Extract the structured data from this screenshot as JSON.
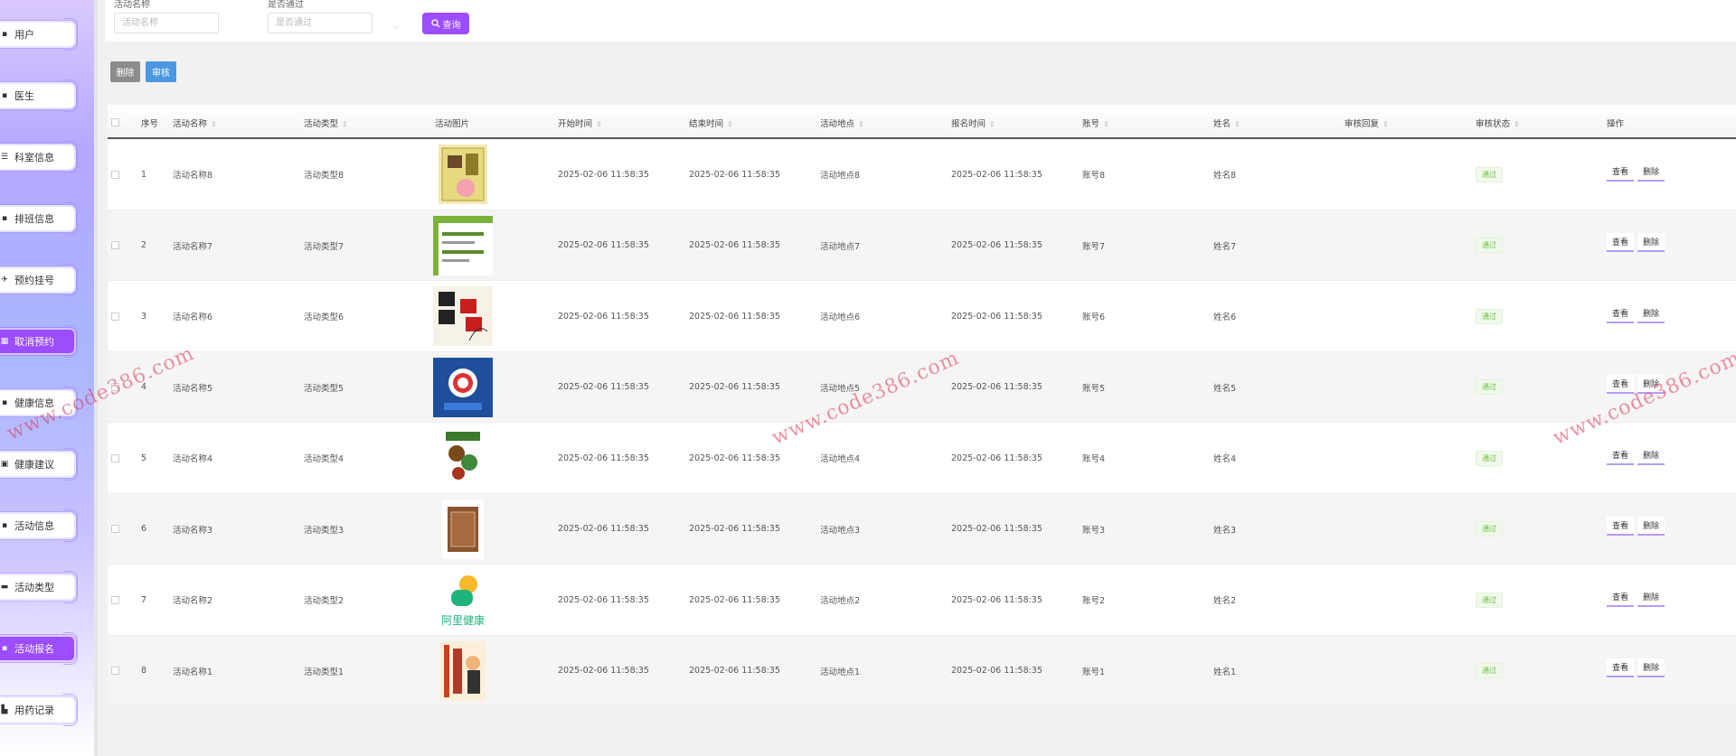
{
  "sidebar": {
    "items": [
      {
        "icon": "user-icon",
        "glyph": "▪",
        "label": "用户",
        "active": false
      },
      {
        "icon": "doctor-icon",
        "glyph": "▪",
        "label": "医生",
        "active": false
      },
      {
        "icon": "department-icon",
        "glyph": "☰",
        "label": "科室信息",
        "active": false
      },
      {
        "icon": "schedule-icon",
        "glyph": "▪",
        "label": "排班信息",
        "active": false
      },
      {
        "icon": "appointment-icon",
        "glyph": "✈",
        "label": "预约挂号",
        "active": false
      },
      {
        "icon": "cancel-appointment-icon",
        "glyph": "▦",
        "label": "取消预约",
        "active": true
      },
      {
        "icon": "health-info-icon",
        "glyph": "▪",
        "label": "健康信息",
        "active": false
      },
      {
        "icon": "health-advice-icon",
        "glyph": "▣",
        "label": "健康建议",
        "active": false
      },
      {
        "icon": "activity-info-icon",
        "glyph": "▪",
        "label": "活动信息",
        "active": false
      },
      {
        "icon": "activity-type-icon",
        "glyph": "▬",
        "label": "活动类型",
        "active": false
      },
      {
        "icon": "activity-signup-icon",
        "glyph": "▪",
        "label": "活动报名",
        "active": true
      },
      {
        "icon": "medication-record-icon",
        "glyph": "▙",
        "label": "用药记录",
        "active": false
      }
    ]
  },
  "search": {
    "activity_name_label": "活动名称",
    "activity_name_placeholder": "活动名称",
    "approved_label": "是否通过",
    "approved_placeholder": "是否通过",
    "query_label": "查询"
  },
  "actions": {
    "delete_label": "删除",
    "audit_label": "审核"
  },
  "table": {
    "columns": [
      "序号",
      "活动名称",
      "活动类型",
      "活动图片",
      "开始时间",
      "结束时间",
      "活动地点",
      "报名时间",
      "账号",
      "姓名",
      "审核回复",
      "审核状态",
      "操作"
    ],
    "rows": [
      {
        "index": "1",
        "name": "活动名称8",
        "type": "活动类型8",
        "image": "book-cover-yellow",
        "start": "2025-02-06 11:58:35",
        "end": "2025-02-06 11:58:35",
        "place": "活动地点8",
        "signup": "2025-02-06 11:58:35",
        "account": "账号8",
        "realname": "姓名8",
        "reply": "",
        "status": "通过"
      },
      {
        "index": "2",
        "name": "活动名称7",
        "type": "活动类型7",
        "image": "book-cover-green",
        "start": "2025-02-06 11:58:35",
        "end": "2025-02-06 11:58:35",
        "place": "活动地点7",
        "signup": "2025-02-06 11:58:35",
        "account": "账号7",
        "realname": "姓名7",
        "reply": "",
        "status": "通过"
      },
      {
        "index": "3",
        "name": "活动名称6",
        "type": "活动类型6",
        "image": "book-cover-health",
        "start": "2025-02-06 11:58:35",
        "end": "2025-02-06 11:58:35",
        "place": "活动地点6",
        "signup": "2025-02-06 11:58:35",
        "account": "账号6",
        "realname": "姓名6",
        "reply": "",
        "status": "通过"
      },
      {
        "index": "4",
        "name": "活动名称5",
        "type": "活动类型5",
        "image": "book-cover-blue",
        "start": "2025-02-06 11:58:35",
        "end": "2025-02-06 11:58:35",
        "place": "活动地点5",
        "signup": "2025-02-06 11:58:35",
        "account": "账号5",
        "realname": "姓名5",
        "reply": "",
        "status": "通过"
      },
      {
        "index": "5",
        "name": "活动名称4",
        "type": "活动类型4",
        "image": "book-cover-food",
        "start": "2025-02-06 11:58:35",
        "end": "2025-02-06 11:58:35",
        "place": "活动地点4",
        "signup": "2025-02-06 11:58:35",
        "account": "账号4",
        "realname": "姓名4",
        "reply": "",
        "status": "通过"
      },
      {
        "index": "6",
        "name": "活动名称3",
        "type": "活动类型3",
        "image": "book-cover-brown",
        "start": "2025-02-06 11:58:35",
        "end": "2025-02-06 11:58:35",
        "place": "活动地点3",
        "signup": "2025-02-06 11:58:35",
        "account": "账号3",
        "realname": "姓名3",
        "reply": "",
        "status": "通过"
      },
      {
        "index": "7",
        "name": "活动名称2",
        "type": "活动类型2",
        "image": "alihealth-logo",
        "start": "2025-02-06 11:58:35",
        "end": "2025-02-06 11:58:35",
        "place": "活动地点2",
        "signup": "2025-02-06 11:58:35",
        "account": "账号2",
        "realname": "姓名2",
        "reply": "",
        "status": "通过"
      },
      {
        "index": "8",
        "name": "活动名称1",
        "type": "活动类型1",
        "image": "book-cover-orange",
        "start": "2025-02-06 11:58:35",
        "end": "2025-02-06 11:58:35",
        "place": "活动地点1",
        "signup": "2025-02-06 11:58:35",
        "account": "账号1",
        "realname": "姓名1",
        "reply": "",
        "status": "通过"
      }
    ],
    "view_label": "查看",
    "delete_label": "删除"
  },
  "watermark": "www.code386.com",
  "colors": {
    "accent": "#9b4dff",
    "audit": "#4b97e0",
    "delete": "#8c8c8c",
    "status_ok": "#67c23a"
  }
}
